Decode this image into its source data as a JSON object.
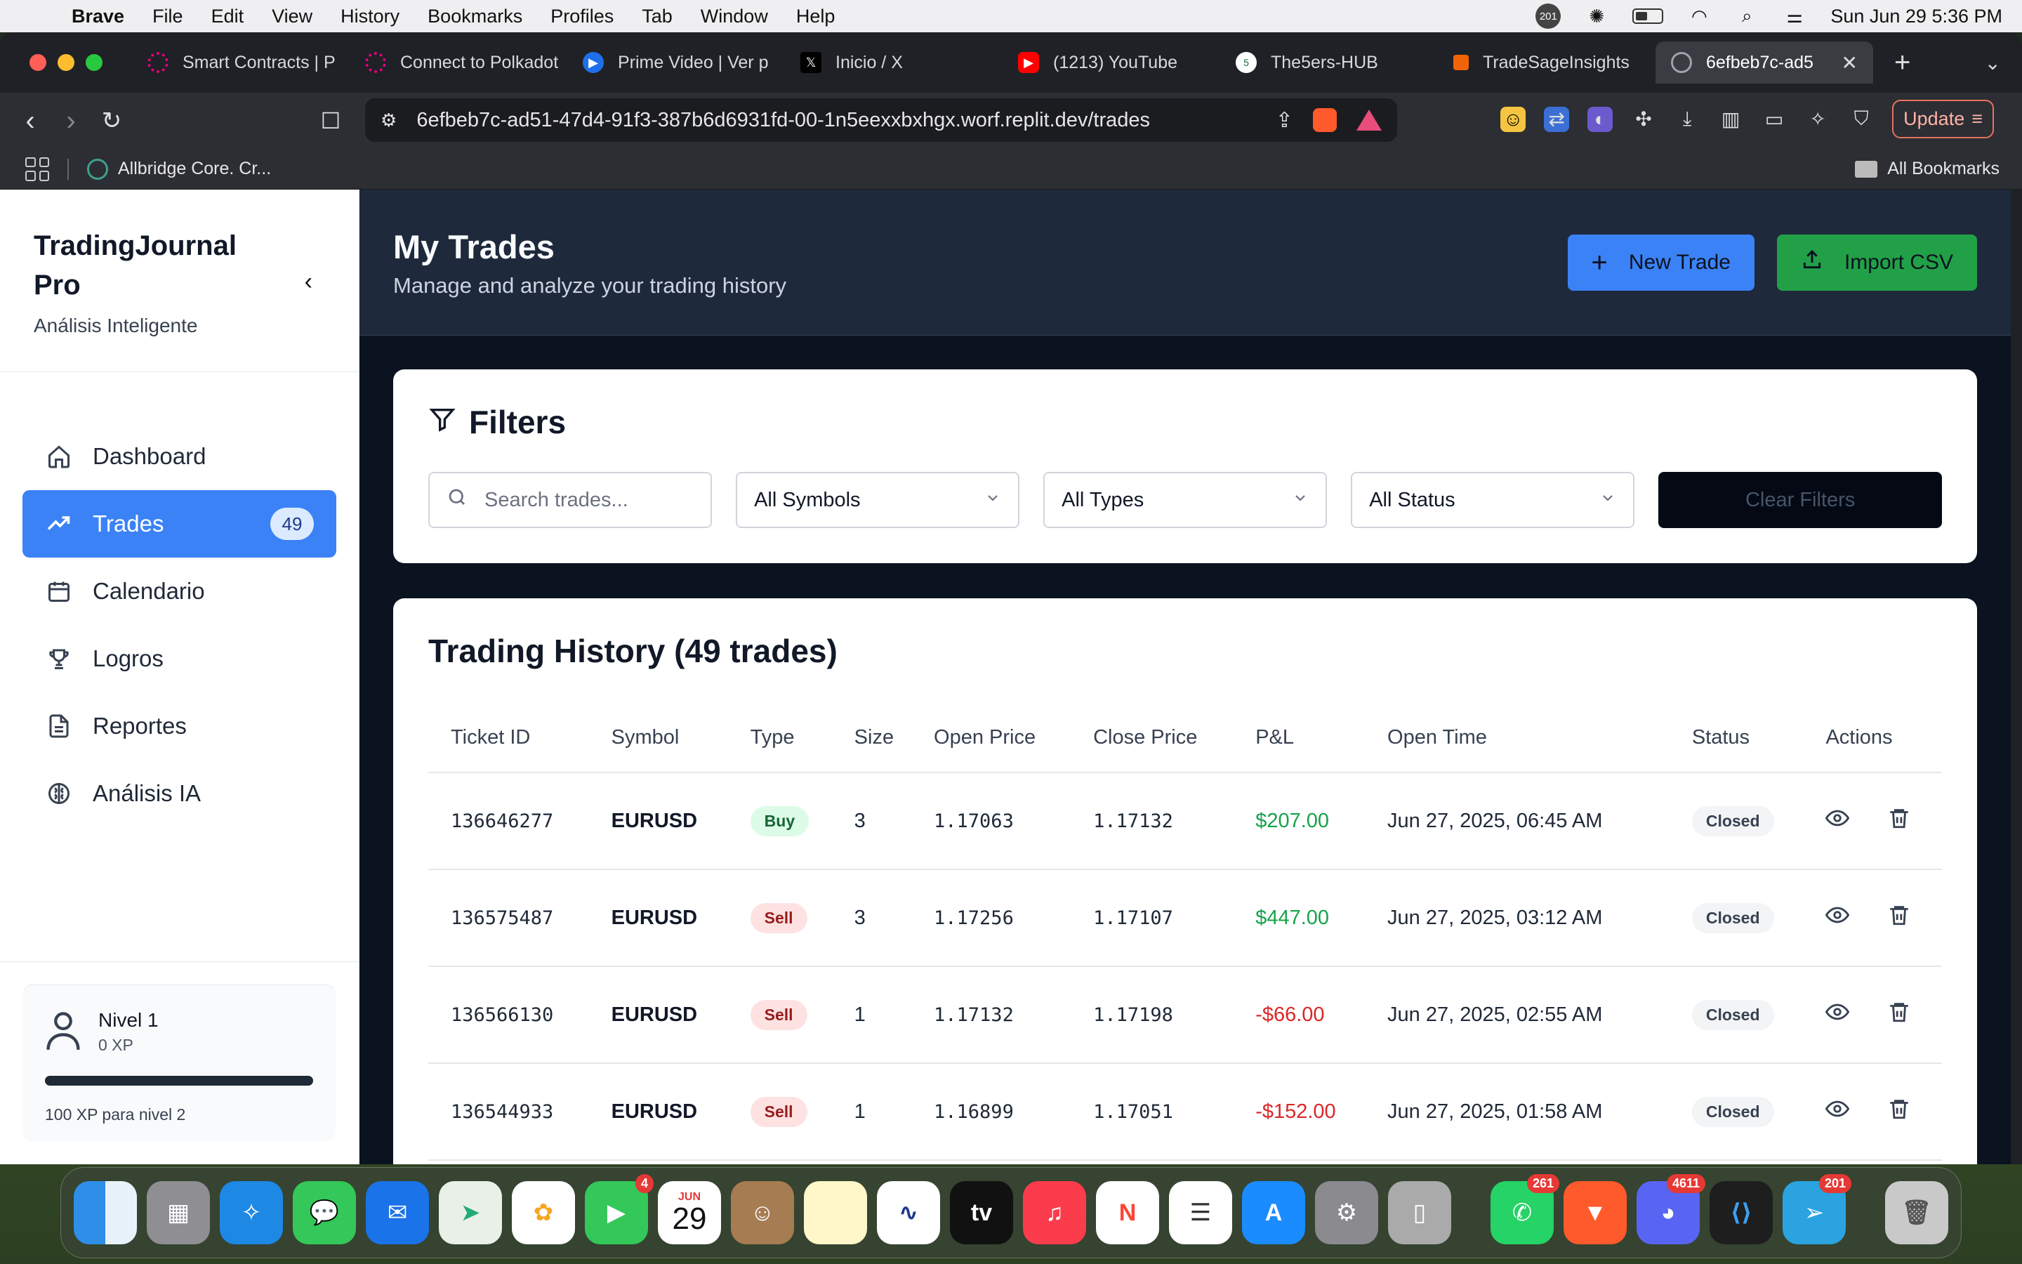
{
  "menubar": {
    "app": "Brave",
    "items": [
      "File",
      "Edit",
      "View",
      "History",
      "Bookmarks",
      "Profiles",
      "Tab",
      "Window",
      "Help"
    ],
    "badge": "201",
    "datetime": "Sun Jun 29  5:36 PM"
  },
  "tabs": [
    {
      "label": "Smart Contracts | P",
      "color": "#e6007a"
    },
    {
      "label": "Connect to Polkadot",
      "color": "#e6007a"
    },
    {
      "label": "Prime Video | Ver p",
      "color": "#1f6feb"
    },
    {
      "label": "Inicio / X",
      "color": "#000000"
    },
    {
      "label": "(1213) YouTube",
      "color": "#ff0000"
    },
    {
      "label": "The5ers-HUB",
      "color": "#ffffff"
    },
    {
      "label": "TradeSageInsights",
      "color": "#f26207"
    },
    {
      "label": "6efbeb7c-ad5",
      "color": "#9ca3af"
    }
  ],
  "toolbar": {
    "url": "6efbeb7c-ad51-47d4-91f3-387b6d6931fd-00-1n5eexxbxhgx.worf.replit.dev/trades",
    "update_label": "Update"
  },
  "bookmarks": {
    "item1": "Allbridge Core. Cr...",
    "all": "All Bookmarks"
  },
  "sidebar": {
    "title": "TradingJournal Pro",
    "subtitle": "Análisis Inteligente",
    "items": [
      {
        "label": "Dashboard",
        "icon": "home-icon"
      },
      {
        "label": "Trades",
        "icon": "trending-up-icon",
        "count": "49"
      },
      {
        "label": "Calendario",
        "icon": "calendar-icon"
      },
      {
        "label": "Logros",
        "icon": "trophy-icon"
      },
      {
        "label": "Reportes",
        "icon": "file-text-icon"
      },
      {
        "label": "Análisis IA",
        "icon": "brain-icon"
      }
    ],
    "level": {
      "title": "Nivel 1",
      "xp": "0 XP",
      "next": "100 XP para nivel 2",
      "progress": 0
    }
  },
  "header": {
    "title": "My Trades",
    "subtitle": "Manage and analyze your trading history",
    "new_trade": "New Trade",
    "import_csv": "Import CSV"
  },
  "filters": {
    "title": "Filters",
    "search_placeholder": "Search trades...",
    "symbols": "All Symbols",
    "types": "All Types",
    "status": "All Status",
    "clear": "Clear Filters"
  },
  "history": {
    "title": "Trading History (49 trades)",
    "columns": [
      "Ticket ID",
      "Symbol",
      "Type",
      "Size",
      "Open Price",
      "Close Price",
      "P&L",
      "Open Time",
      "Status",
      "Actions"
    ],
    "rows": [
      {
        "ticket": "136646277",
        "symbol": "EURUSD",
        "type": "Buy",
        "size": "3",
        "open": "1.17063",
        "close": "1.17132",
        "pnl": "$207.00",
        "time": "Jun 27, 2025, 06:45 AM",
        "status": "Closed"
      },
      {
        "ticket": "136575487",
        "symbol": "EURUSD",
        "type": "Sell",
        "size": "3",
        "open": "1.17256",
        "close": "1.17107",
        "pnl": "$447.00",
        "time": "Jun 27, 2025, 03:12 AM",
        "status": "Closed"
      },
      {
        "ticket": "136566130",
        "symbol": "EURUSD",
        "type": "Sell",
        "size": "1",
        "open": "1.17132",
        "close": "1.17198",
        "pnl": "-$66.00",
        "time": "Jun 27, 2025, 02:55 AM",
        "status": "Closed"
      },
      {
        "ticket": "136544933",
        "symbol": "EURUSD",
        "type": "Sell",
        "size": "1",
        "open": "1.16899",
        "close": "1.17051",
        "pnl": "-$152.00",
        "time": "Jun 27, 2025, 01:58 AM",
        "status": "Closed"
      }
    ]
  },
  "dock": {
    "calendar_month": "JUN",
    "calendar_day": "29",
    "badges": {
      "facetime": "4",
      "whatsapp": "261",
      "discord": "4611",
      "telegram": "201"
    }
  }
}
